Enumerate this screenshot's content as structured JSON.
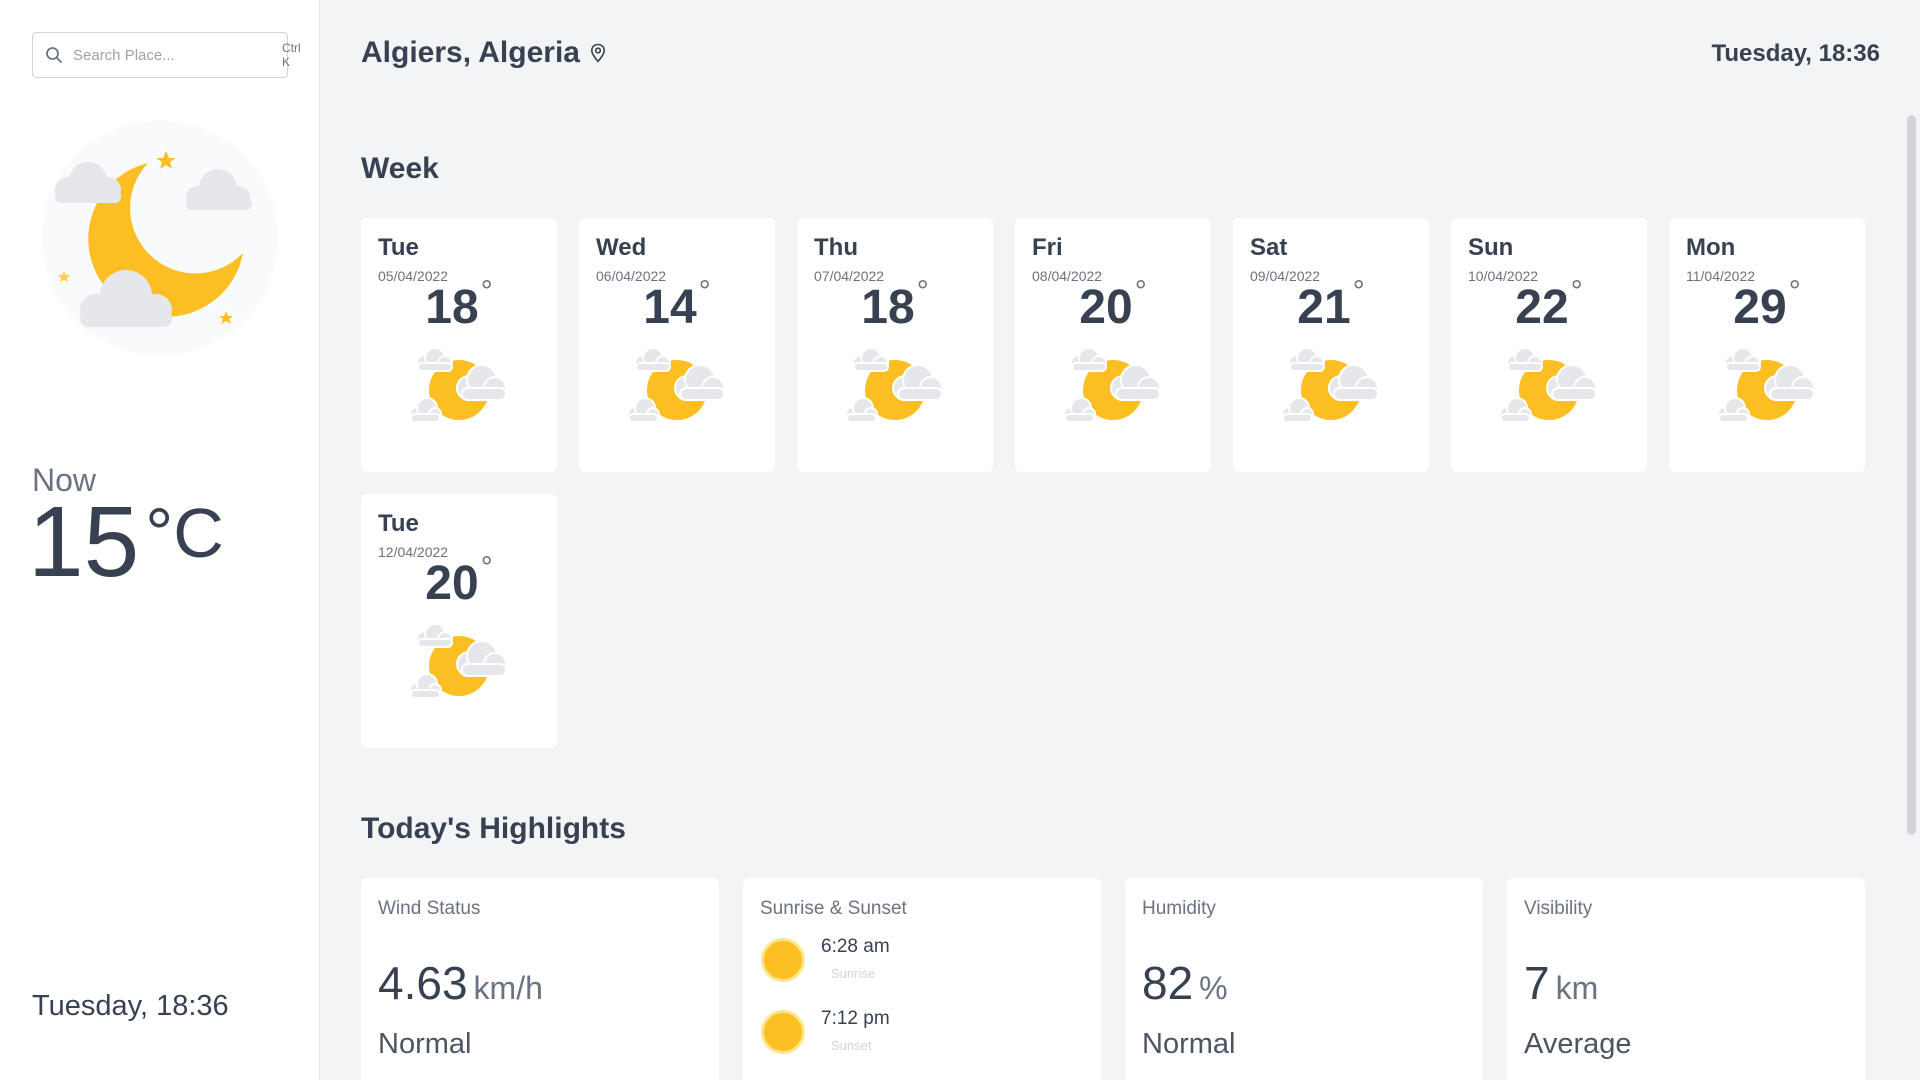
{
  "search": {
    "placeholder": "Search Place...",
    "shortcut": "Ctrl K"
  },
  "current": {
    "icon": "moon-cloud-icon",
    "label": "Now",
    "temp": "15",
    "unit": "°C",
    "datetime": "Tuesday, 18:36"
  },
  "header": {
    "location": "Algiers, Algeria",
    "datetime": "Tuesday, 18:36"
  },
  "week": {
    "title": "Week",
    "days": [
      {
        "name": "Tue",
        "date": "05/04/2022",
        "temp": "18",
        "icon": "sun-cloud-icon"
      },
      {
        "name": "Wed",
        "date": "06/04/2022",
        "temp": "14",
        "icon": "sun-cloud-icon"
      },
      {
        "name": "Thu",
        "date": "07/04/2022",
        "temp": "18",
        "icon": "sun-cloud-icon"
      },
      {
        "name": "Fri",
        "date": "08/04/2022",
        "temp": "20",
        "icon": "sun-cloud-icon"
      },
      {
        "name": "Sat",
        "date": "09/04/2022",
        "temp": "21",
        "icon": "sun-cloud-icon"
      },
      {
        "name": "Sun",
        "date": "10/04/2022",
        "temp": "22",
        "icon": "sun-cloud-icon"
      },
      {
        "name": "Mon",
        "date": "11/04/2022",
        "temp": "29",
        "icon": "sun-cloud-icon"
      },
      {
        "name": "Tue",
        "date": "12/04/2022",
        "temp": "20",
        "icon": "sun-cloud-icon"
      }
    ],
    "degree_symbol": "°"
  },
  "highlights": {
    "title": "Today's Highlights",
    "wind": {
      "title": "Wind Status",
      "value": "4.63",
      "unit": "km/h",
      "status": "Normal"
    },
    "sun": {
      "title": "Sunrise & Sunset",
      "sunrise_time": "6:28 am",
      "sunrise_label": "Sunrise",
      "sunset_time": "7:12 pm",
      "sunset_label": "Sunset"
    },
    "humidity": {
      "title": "Humidity",
      "value": "82",
      "unit": "%",
      "status": "Normal"
    },
    "visibility": {
      "title": "Visibility",
      "value": "7",
      "unit": "km",
      "status": "Average"
    }
  },
  "colors": {
    "accent": "#fbbf24",
    "text": "#374151",
    "muted": "#6b7280",
    "background": "#f3f4f6",
    "card": "#ffffff"
  }
}
